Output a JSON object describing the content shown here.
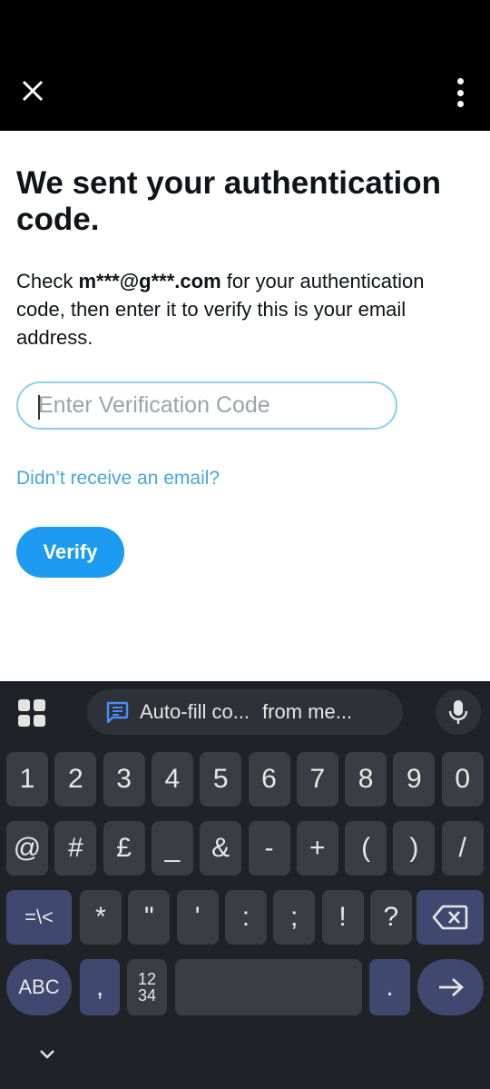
{
  "app": {
    "close_icon": "x-close-icon",
    "menu_icon": "kebab-menu-icon"
  },
  "page": {
    "title": "We sent your authentication code.",
    "desc_prefix": "Check ",
    "desc_email": "m***@g***.com",
    "desc_suffix": " for your authentication code, then enter it to verify this is your email address.",
    "input_placeholder": "Enter Verification Code",
    "input_value": "",
    "resend_link": "Didn’t receive an email?",
    "verify_label": "Verify"
  },
  "keyboard": {
    "suggestion_part1": "Auto-fill co...",
    "suggestion_part2": "from me...",
    "row1": [
      "1",
      "2",
      "3",
      "4",
      "5",
      "6",
      "7",
      "8",
      "9",
      "0"
    ],
    "row2": [
      "@",
      "#",
      "£",
      "_",
      "&",
      "-",
      "+",
      "(",
      ")",
      "/"
    ],
    "row3": [
      "=\\<",
      "*",
      "\"",
      "'",
      ":",
      ";",
      "!",
      "?"
    ],
    "abc_label": "ABC",
    "comma_label": ",",
    "numpad_top": "12",
    "numpad_bottom": "34",
    "period_label": ".",
    "icons": [
      "apps-grid-icon",
      "message-icon",
      "microphone-icon",
      "backspace-icon",
      "enter-arrow-icon",
      "chevron-down-icon"
    ]
  },
  "colors": {
    "accent": "#1d9bf0",
    "link": "#4aa6d9",
    "input_border": "#8ecdf2",
    "keyboard_bg": "#1f2227"
  }
}
